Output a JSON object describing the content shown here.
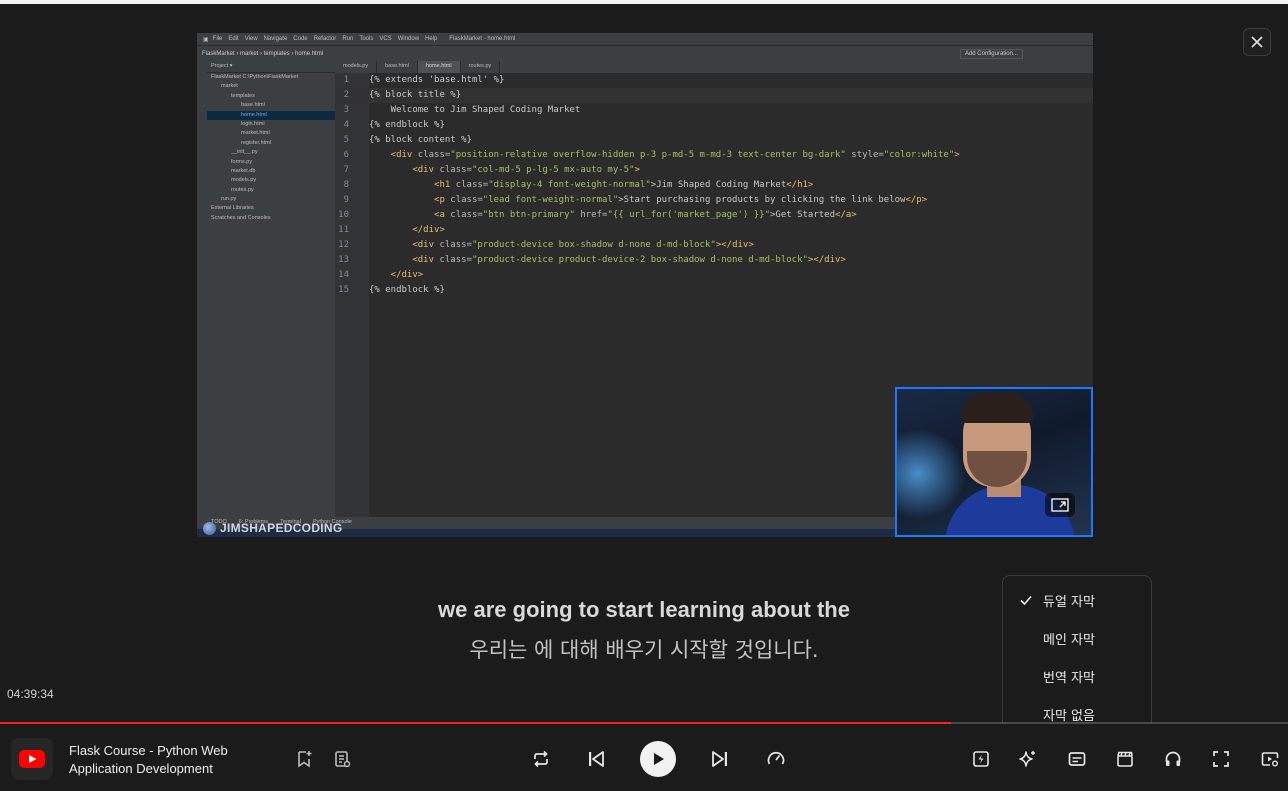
{
  "subtitles": {
    "main": "we are going to start learning about the",
    "translation": "우리는 에 대해 배우기 시작할 것입니다."
  },
  "player": {
    "timestamp": "04:39:34",
    "progress_percent": 73.8,
    "accent_color": "#ff1f1f",
    "video_title": "Flask Course - Python Web Application Development"
  },
  "caption_menu": {
    "items": [
      {
        "label": "듀얼 자막",
        "checked": true
      },
      {
        "label": "메인 자막",
        "checked": false
      },
      {
        "label": "번역 자막",
        "checked": false
      },
      {
        "label": "자막 없음",
        "checked": false
      }
    ]
  },
  "video_frame": {
    "watermark": "JIMSHAPEDCODING",
    "ide": {
      "menu": [
        "File",
        "Edit",
        "View",
        "Navigate",
        "Code",
        "Refactor",
        "Run",
        "Tools",
        "VCS",
        "Window",
        "Help"
      ],
      "window_title": "FlaskMarket - home.html",
      "breadcrumb": "FlaskMarket  ›  market  ›  templates  ›  home.html",
      "run_config": "Add Configuration...",
      "tabs": [
        {
          "label": "models.py",
          "active": false
        },
        {
          "label": "base.html",
          "active": false
        },
        {
          "label": "home.html",
          "active": true
        },
        {
          "label": "routes.py",
          "active": false
        }
      ],
      "project_header": "Project ▾",
      "project_tree": [
        {
          "label": "FlaskMarket  C:\\Python\\FlaskMarket",
          "indent": 0,
          "selected": false
        },
        {
          "label": "market",
          "indent": 1,
          "selected": false
        },
        {
          "label": "templates",
          "indent": 2,
          "selected": false
        },
        {
          "label": "base.html",
          "indent": 3,
          "selected": false
        },
        {
          "label": "home.html",
          "indent": 3,
          "selected": true
        },
        {
          "label": "login.html",
          "indent": 3,
          "selected": false
        },
        {
          "label": "market.html",
          "indent": 3,
          "selected": false
        },
        {
          "label": "register.html",
          "indent": 3,
          "selected": false
        },
        {
          "label": "__init__.py",
          "indent": 2,
          "selected": false
        },
        {
          "label": "forms.py",
          "indent": 2,
          "selected": false
        },
        {
          "label": "market.db",
          "indent": 2,
          "selected": false
        },
        {
          "label": "models.py",
          "indent": 2,
          "selected": false
        },
        {
          "label": "routes.py",
          "indent": 2,
          "selected": false
        },
        {
          "label": "run.py",
          "indent": 1,
          "selected": false
        },
        {
          "label": "External Libraries",
          "indent": 0,
          "selected": false
        },
        {
          "label": "Scratches and Consoles",
          "indent": 0,
          "selected": false
        }
      ],
      "bottom_tools": [
        "TODO",
        "6: Problems",
        "Terminal",
        "Python Console"
      ],
      "code_lines": [
        [
          {
            "t": "{% extends 'base.html' %}",
            "c": "ct"
          }
        ],
        [
          {
            "t": "{% block title %}",
            "c": "ct"
          }
        ],
        [
          {
            "t": "    Welcome to Jim Shaped Coding Market",
            "c": "ct"
          }
        ],
        [
          {
            "t": "{% endblock %}",
            "c": "ct"
          }
        ],
        [
          {
            "t": "{% block content %}",
            "c": "ct"
          }
        ],
        [
          {
            "t": "    <div ",
            "c": "tag"
          },
          {
            "t": "class=",
            "c": "attr"
          },
          {
            "t": "\"position-relative overflow-hidden p-3 p-md-5 m-md-3 text-center bg-dark\"",
            "c": "str"
          },
          {
            "t": " style=",
            "c": "attr"
          },
          {
            "t": "\"color:white\"",
            "c": "str"
          },
          {
            "t": ">",
            "c": "tag"
          }
        ],
        [
          {
            "t": "        <div ",
            "c": "tag"
          },
          {
            "t": "class=",
            "c": "attr"
          },
          {
            "t": "\"col-md-5 p-lg-5 mx-auto my-5\"",
            "c": "str"
          },
          {
            "t": ">",
            "c": "tag"
          }
        ],
        [
          {
            "t": "            <h1 ",
            "c": "tag"
          },
          {
            "t": "class=",
            "c": "attr"
          },
          {
            "t": "\"display-4 font-weight-normal\"",
            "c": "str"
          },
          {
            "t": ">Jim Shaped Coding Market",
            "c": "ct"
          },
          {
            "t": "</h1>",
            "c": "tag"
          }
        ],
        [
          {
            "t": "            <p ",
            "c": "tag"
          },
          {
            "t": "class=",
            "c": "attr"
          },
          {
            "t": "\"lead font-weight-normal\"",
            "c": "str"
          },
          {
            "t": ">Start purchasing products by clicking the link below",
            "c": "ct"
          },
          {
            "t": "</p>",
            "c": "tag"
          }
        ],
        [
          {
            "t": "            <a ",
            "c": "tag"
          },
          {
            "t": "class=",
            "c": "attr"
          },
          {
            "t": "\"btn btn-primary\"",
            "c": "str"
          },
          {
            "t": " href=",
            "c": "attr"
          },
          {
            "t": "\"{{ url_for('market_page') }}\"",
            "c": "str"
          },
          {
            "t": ">Get Started",
            "c": "ct"
          },
          {
            "t": "</a>",
            "c": "tag"
          }
        ],
        [
          {
            "t": "        </div>",
            "c": "tag"
          }
        ],
        [
          {
            "t": "        <div ",
            "c": "tag"
          },
          {
            "t": "class=",
            "c": "attr"
          },
          {
            "t": "\"product-device box-shadow d-none d-md-block\"",
            "c": "str"
          },
          {
            "t": "></div>",
            "c": "tag"
          }
        ],
        [
          {
            "t": "        <div ",
            "c": "tag"
          },
          {
            "t": "class=",
            "c": "attr"
          },
          {
            "t": "\"product-device product-device-2 box-shadow d-none d-md-block\"",
            "c": "str"
          },
          {
            "t": "></div>",
            "c": "tag"
          }
        ],
        [
          {
            "t": "    </div>",
            "c": "tag"
          }
        ],
        [
          {
            "t": "{% endblock %}",
            "c": "ct"
          }
        ]
      ]
    }
  },
  "icons": {
    "close": "close-icon",
    "add_bookmark": "bookmark-add-icon",
    "notes": "notes-icon",
    "loop": "repeat-icon",
    "previous": "skip-previous-icon",
    "play": "play-icon",
    "next": "skip-next-icon",
    "speed": "speed-icon",
    "summary": "summary-icon",
    "ai": "sparkle-icon",
    "captions": "captions-icon",
    "clips": "clapper-icon",
    "audio": "headphones-icon",
    "fullscreen": "fullscreen-icon",
    "settings": "video-settings-icon"
  }
}
